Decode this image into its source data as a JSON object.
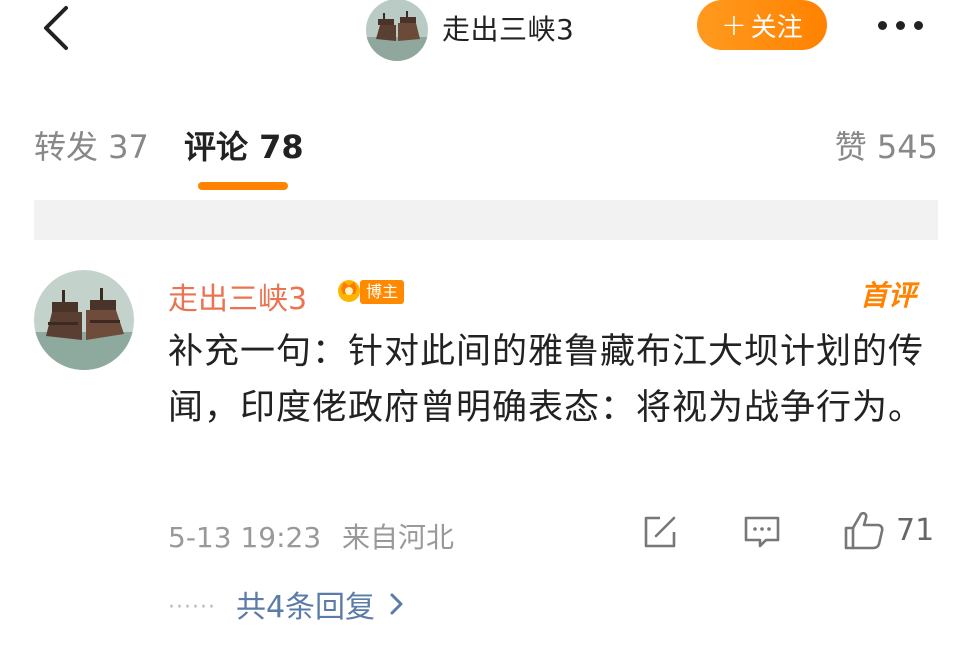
{
  "header": {
    "title": "走出三峡3",
    "follow_label": "关注",
    "follow_plus": "+",
    "back_icon": "chevron-left-icon",
    "more_icon": "more-horizontal-icon"
  },
  "tabs": [
    {
      "label": "转发 37",
      "active": false
    },
    {
      "label": "评论 78",
      "active": true
    },
    {
      "label": "赞 545",
      "active": false
    }
  ],
  "colors": {
    "accent": "#ff8200",
    "username": "#eb7350",
    "link": "#5b7ba8"
  },
  "comment": {
    "username": "走出三峡3",
    "badge": "博主",
    "top_tag": "首评",
    "body": "补充一句：针对此间的雅鲁藏布江大坝计划的传闻，印度佬政府曾明确表态：将视为战争行为。",
    "time": "5-13 19:23",
    "source": "来自河北",
    "likes": "71",
    "replies_dots": "······",
    "replies_label": "共4条回复"
  }
}
